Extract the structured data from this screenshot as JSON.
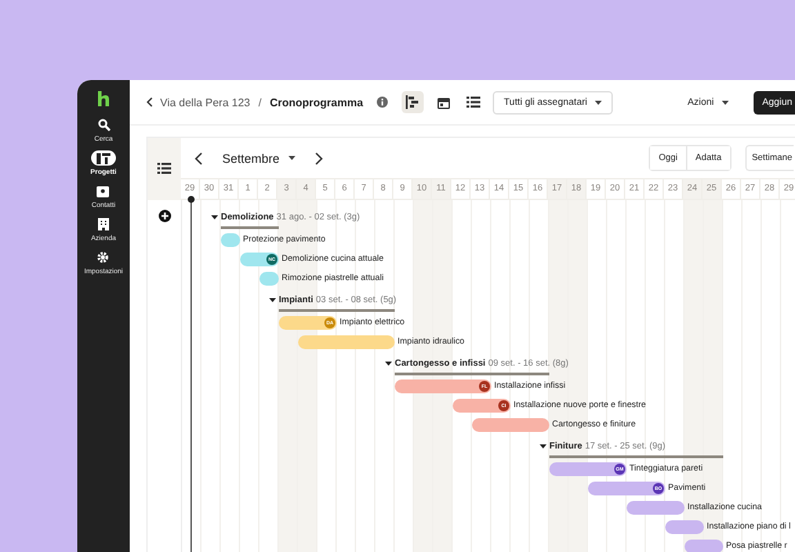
{
  "sidebar": {
    "items": [
      {
        "label": "Cerca",
        "kind": "search",
        "selected": false
      },
      {
        "label": "Progetti",
        "kind": "projects",
        "selected": true
      },
      {
        "label": "Contatti",
        "kind": "contacts",
        "selected": false
      },
      {
        "label": "Azienda",
        "kind": "building",
        "selected": false
      },
      {
        "label": "Impostazioni",
        "kind": "gear",
        "selected": false
      }
    ]
  },
  "header": {
    "breadcrumb": "Via della Pera 123",
    "separator": "/",
    "title": "Cronoprogramma",
    "views": [
      {
        "kind": "gantt",
        "selected": true
      },
      {
        "kind": "calendar",
        "selected": false
      },
      {
        "kind": "list",
        "selected": false
      }
    ],
    "assignee_filter": "Tutti gli assegnatari",
    "actions": "Azioni",
    "add_button": "Aggiun"
  },
  "toolbar": {
    "month": "Settembre",
    "today": "Oggi",
    "fit": "Adatta",
    "scale": "Settimane"
  },
  "days": [
    {
      "label": "29",
      "weekend": false
    },
    {
      "label": "30",
      "weekend": false
    },
    {
      "label": "31",
      "weekend": false
    },
    {
      "label": "1",
      "weekend": false
    },
    {
      "label": "2",
      "weekend": false
    },
    {
      "label": "3",
      "weekend": true
    },
    {
      "label": "4",
      "weekend": true
    },
    {
      "label": "5",
      "weekend": false
    },
    {
      "label": "6",
      "weekend": false
    },
    {
      "label": "7",
      "weekend": false
    },
    {
      "label": "8",
      "weekend": false
    },
    {
      "label": "9",
      "weekend": false
    },
    {
      "label": "10",
      "weekend": true
    },
    {
      "label": "11",
      "weekend": true
    },
    {
      "label": "12",
      "weekend": false
    },
    {
      "label": "13",
      "weekend": false
    },
    {
      "label": "14",
      "weekend": false
    },
    {
      "label": "15",
      "weekend": false
    },
    {
      "label": "16",
      "weekend": false
    },
    {
      "label": "17",
      "weekend": true
    },
    {
      "label": "18",
      "weekend": true
    },
    {
      "label": "19",
      "weekend": false
    },
    {
      "label": "20",
      "weekend": false
    },
    {
      "label": "21",
      "weekend": false
    },
    {
      "label": "22",
      "weekend": false
    },
    {
      "label": "23",
      "weekend": false
    },
    {
      "label": "24",
      "weekend": true
    },
    {
      "label": "25",
      "weekend": true
    },
    {
      "label": "26",
      "weekend": false
    },
    {
      "label": "27",
      "weekend": false
    },
    {
      "label": "28",
      "weekend": false
    },
    {
      "label": "29",
      "weekend": false
    }
  ],
  "groups": [
    {
      "name": "Demolizione",
      "dates": "31 ago. - 02 set. (3g)",
      "color": "#9fe6ee",
      "expanded": true,
      "tasks": [
        {
          "name": "Protezione pavimento"
        },
        {
          "name": "Demolizione cucina attuale",
          "assignee": {
            "initials": "NC",
            "color": "#0f6b63"
          }
        },
        {
          "name": "Rimozione piastrelle attuali"
        }
      ]
    },
    {
      "name": "Impianti",
      "dates": "03 set. - 08 set. (5g)",
      "color": "#fcd98a",
      "expanded": true,
      "tasks": [
        {
          "name": "Impianto elettrico",
          "assignee": {
            "initials": "DA",
            "color": "#c98a0a"
          }
        },
        {
          "name": "Impianto idraulico"
        }
      ]
    },
    {
      "name": "Cartongesso e infissi",
      "dates": "09 set. - 16 set. (8g)",
      "color": "#f8b2a6",
      "expanded": true,
      "tasks": [
        {
          "name": "Installazione infissi",
          "assignee": {
            "initials": "FL",
            "color": "#a8321f"
          }
        },
        {
          "name": "Installazione nuove porte e finestre",
          "assignee": {
            "initials": "CI",
            "color": "#a8321f"
          }
        },
        {
          "name": "Cartongesso e finiture"
        }
      ]
    },
    {
      "name": "Finiture",
      "dates": "17 set. - 25 set. (9g)",
      "color": "#c9b6f0",
      "expanded": true,
      "tasks": [
        {
          "name": "Tinteggiatura pareti",
          "assignee": {
            "initials": "GM",
            "color": "#5b35b5"
          }
        },
        {
          "name": "Pavimenti",
          "assignee": {
            "initials": "BO",
            "color": "#5b35b5"
          }
        },
        {
          "name": "Installazione cucina"
        },
        {
          "name": "Installazione piano di l"
        },
        {
          "name": "Posa piastrelle r"
        }
      ]
    }
  ]
}
